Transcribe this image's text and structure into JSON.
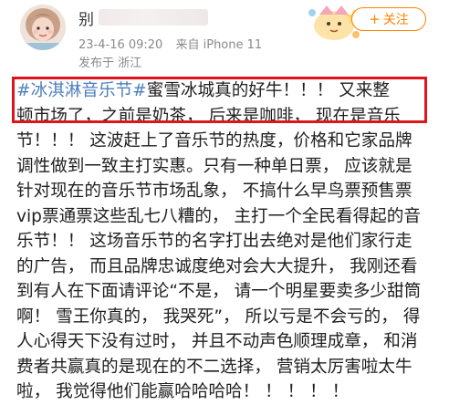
{
  "post": {
    "author": {
      "name_visible": "别"
    },
    "timestamp": "23-4-16 09:20",
    "source": "来自 iPhone 11",
    "location": "发布于 浙江",
    "follow_label": "关注",
    "follow_plus": "+",
    "content_lines": [
      {
        "hashtag": "#冰淇淋音乐节#",
        "text": "蜜雪冰城真的好牛！！！ 又来整"
      },
      {
        "hashtag": "",
        "text": "顿市场了，之前是奶茶， 后来是咖啡， 现在是音乐"
      },
      {
        "hashtag": "",
        "text": "节！！！ 这波赶上了音乐节的热度，价格和它家品牌"
      },
      {
        "hashtag": "",
        "text": "调性做到一致主打实惠。只有一种单日票， 应该就是"
      },
      {
        "hashtag": "",
        "text": "针对现在的音乐节市场乱象， 不搞什么早鸟票预售票"
      },
      {
        "hashtag": "",
        "text": "vip票通票这些乱七八糟的， 主打一个全民看得起的音"
      },
      {
        "hashtag": "",
        "text": "乐节！！ 这场音乐节的名字打出去绝对是他们家行走"
      },
      {
        "hashtag": "",
        "text": "的广告， 而且品牌忠诚度绝对会大大提升， 我刚还看"
      },
      {
        "hashtag": "",
        "text": "到有人在下面请评论“不是， 请一个明星要卖多少甜筒"
      },
      {
        "hashtag": "",
        "text": "啊！ 雪王你真的， 我哭死”， 所以亏是不会亏的， 得"
      },
      {
        "hashtag": "",
        "text": "人心得天下没有过时， 并且不动声色顺理成章， 和消"
      },
      {
        "hashtag": "",
        "text": "费者共赢真的是现在的不二选择， 营销太厉害啦太牛"
      },
      {
        "hashtag": "",
        "text": "啦， 我觉得他们能赢哈哈哈哈！ ！ ！ ！ ！"
      }
    ]
  },
  "colors": {
    "hashtag": "#4d7fbd",
    "follow": "#ff8200",
    "highlight_border": "#e0151b",
    "meta_text": "#8a8a8a"
  },
  "icons": {
    "avatar": "user-avatar-photo",
    "badge": "decorative-cartoon-badge"
  }
}
